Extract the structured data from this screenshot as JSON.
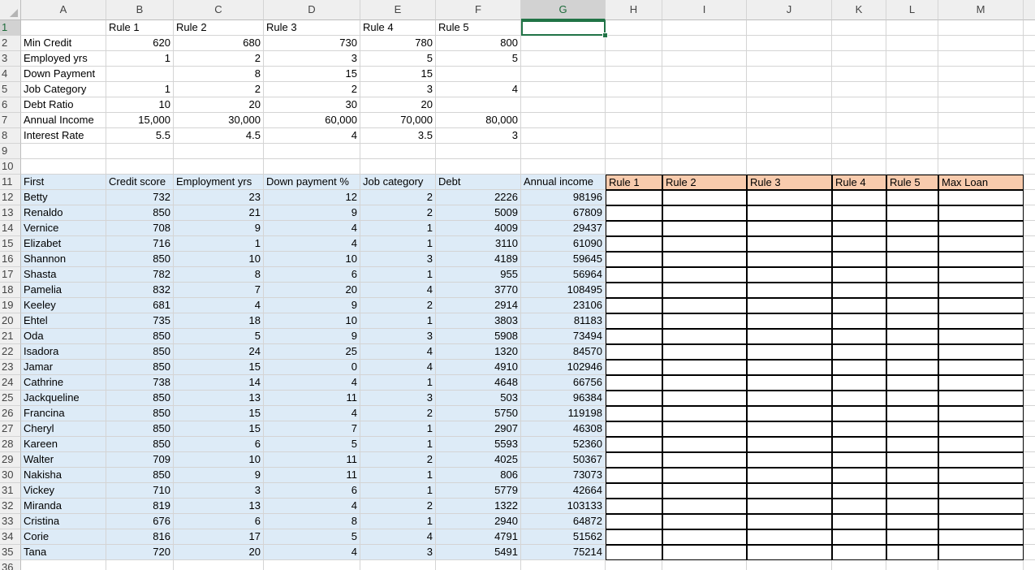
{
  "columns": [
    "A",
    "B",
    "C",
    "D",
    "E",
    "F",
    "G",
    "H",
    "I",
    "J",
    "K",
    "L",
    "M"
  ],
  "selected_column": "G",
  "selected_row": 1,
  "rule_rows": [
    {
      "r": 1,
      "label": "",
      "values": [
        "Rule 1",
        "Rule 2",
        "Rule 3",
        "Rule 4",
        "Rule 5"
      ],
      "header": true
    },
    {
      "r": 2,
      "label": "Min Credit",
      "values": [
        "620",
        "680",
        "730",
        "780",
        "800"
      ]
    },
    {
      "r": 3,
      "label": "Employed yrs",
      "values": [
        "1",
        "2",
        "3",
        "5",
        "5"
      ]
    },
    {
      "r": 4,
      "label": "Down Payment",
      "values": [
        "",
        "8",
        "15",
        "15",
        ""
      ]
    },
    {
      "r": 5,
      "label": "Job Category",
      "values": [
        "1",
        "2",
        "2",
        "3",
        "4"
      ]
    },
    {
      "r": 6,
      "label": "Debt Ratio",
      "values": [
        "10",
        "20",
        "30",
        "20",
        ""
      ]
    },
    {
      "r": 7,
      "label": "Annual Income",
      "values": [
        "15,000",
        "30,000",
        "60,000",
        "70,000",
        "80,000"
      ]
    },
    {
      "r": 8,
      "label": "Interest Rate",
      "values": [
        "5.5",
        "4.5",
        "4",
        "3.5",
        "3"
      ]
    }
  ],
  "applicant_headers": [
    "First",
    "Credit score",
    "Employment yrs",
    "Down payment %",
    "Job category",
    "Debt",
    "Annual income"
  ],
  "result_headers": [
    "Rule 1",
    "Rule 2",
    "Rule 3",
    "Rule 4",
    "Rule 5",
    "Max Loan"
  ],
  "applicants": [
    [
      "Betty",
      "732",
      "23",
      "12",
      "2",
      "2226",
      "98196"
    ],
    [
      "Renaldo",
      "850",
      "21",
      "9",
      "2",
      "5009",
      "67809"
    ],
    [
      "Vernice",
      "708",
      "9",
      "4",
      "1",
      "4009",
      "29437"
    ],
    [
      "Elizabet",
      "716",
      "1",
      "4",
      "1",
      "3110",
      "61090"
    ],
    [
      "Shannon",
      "850",
      "10",
      "10",
      "3",
      "4189",
      "59645"
    ],
    [
      "Shasta",
      "782",
      "8",
      "6",
      "1",
      "955",
      "56964"
    ],
    [
      "Pamelia",
      "832",
      "7",
      "20",
      "4",
      "3770",
      "108495"
    ],
    [
      "Keeley",
      "681",
      "4",
      "9",
      "2",
      "2914",
      "23106"
    ],
    [
      "Ehtel",
      "735",
      "18",
      "10",
      "1",
      "3803",
      "81183"
    ],
    [
      "Oda",
      "850",
      "5",
      "9",
      "3",
      "5908",
      "73494"
    ],
    [
      "Isadora",
      "850",
      "24",
      "25",
      "4",
      "1320",
      "84570"
    ],
    [
      "Jamar",
      "850",
      "15",
      "0",
      "4",
      "4910",
      "102946"
    ],
    [
      "Cathrine",
      "738",
      "14",
      "4",
      "1",
      "4648",
      "66756"
    ],
    [
      "Jackqueline",
      "850",
      "13",
      "11",
      "3",
      "503",
      "96384"
    ],
    [
      "Francina",
      "850",
      "15",
      "4",
      "2",
      "5750",
      "119198"
    ],
    [
      "Cheryl",
      "850",
      "15",
      "7",
      "1",
      "2907",
      "46308"
    ],
    [
      "Kareen",
      "850",
      "6",
      "5",
      "1",
      "5593",
      "52360"
    ],
    [
      "Walter",
      "709",
      "10",
      "11",
      "2",
      "4025",
      "50367"
    ],
    [
      "Nakisha",
      "850",
      "9",
      "11",
      "1",
      "806",
      "73073"
    ],
    [
      "Vickey",
      "710",
      "3",
      "6",
      "1",
      "5779",
      "42664"
    ],
    [
      "Miranda",
      "819",
      "13",
      "4",
      "2",
      "1322",
      "103133"
    ],
    [
      "Cristina",
      "676",
      "6",
      "8",
      "1",
      "2940",
      "64872"
    ],
    [
      "Corie",
      "816",
      "17",
      "5",
      "4",
      "4791",
      "51562"
    ],
    [
      "Tana",
      "720",
      "20",
      "4",
      "3",
      "5491",
      "75214"
    ]
  ],
  "row_numbers": [
    "1",
    "2",
    "3",
    "4",
    "5",
    "6",
    "7",
    "8",
    "9",
    "10",
    "11",
    "12",
    "13",
    "14",
    "15",
    "16",
    "17",
    "18",
    "19",
    "20",
    "21",
    "22",
    "23",
    "24",
    "25",
    "26",
    "27",
    "28",
    "29",
    "30",
    "31",
    "32",
    "33",
    "34",
    "35",
    "36"
  ],
  "colors": {
    "applicant_fill": "#ddebf7",
    "result_header_fill": "#f8cbad",
    "selection": "#217346"
  }
}
